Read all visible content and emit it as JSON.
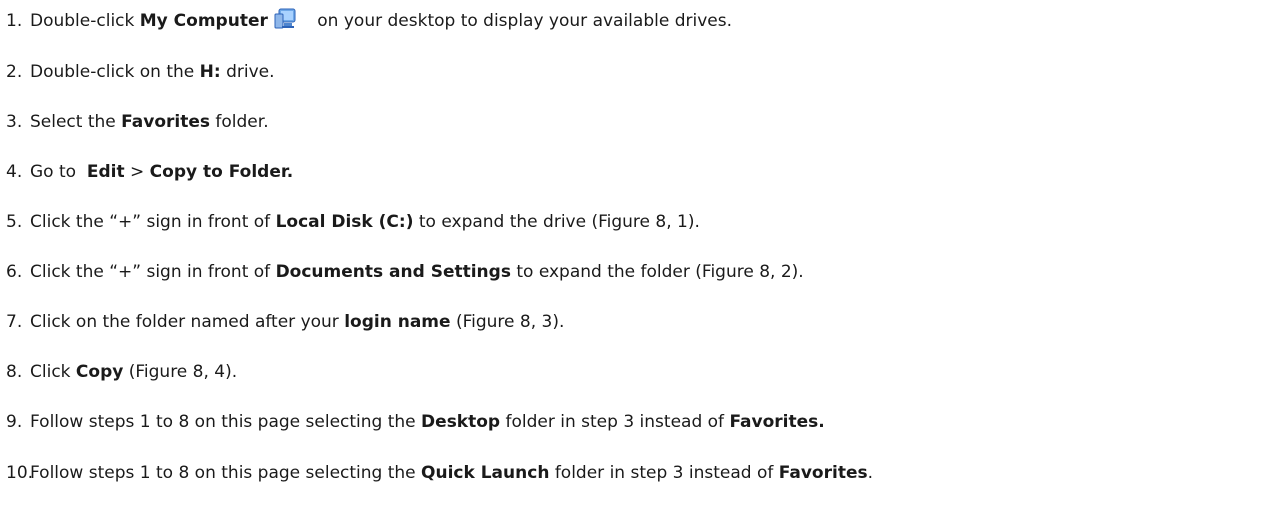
{
  "steps": [
    {
      "number": "1.",
      "parts": [
        "Double-click ",
        "My Computer",
        " on your desktop to display your available drives."
      ],
      "bold": [
        false,
        true,
        false
      ],
      "icon": "my-computer-icon"
    },
    {
      "number": "2.",
      "parts": [
        "Double-click on the ",
        "H:",
        " drive."
      ],
      "bold": [
        false,
        true,
        false
      ]
    },
    {
      "number": "3.",
      "parts": [
        "Select the ",
        "Favorites",
        " folder."
      ],
      "bold": [
        false,
        true,
        false
      ]
    },
    {
      "number": "4.",
      "parts": [
        "Go to  ",
        "Edit",
        " > ",
        "Copy to Folder."
      ],
      "bold": [
        false,
        true,
        false,
        true
      ]
    },
    {
      "number": "5.",
      "parts": [
        "Click the “+” sign in front of ",
        "Local Disk (C:)",
        " to expand the drive (Figure 8, 1)."
      ],
      "bold": [
        false,
        true,
        false
      ]
    },
    {
      "number": "6.",
      "parts": [
        "Click the “+” sign in front of ",
        "Documents and Settings",
        " to expand the folder (Figure 8, 2)."
      ],
      "bold": [
        false,
        true,
        false
      ]
    },
    {
      "number": "7.",
      "parts": [
        "Click on the folder named after your ",
        "login name",
        " (Figure 8, 3)."
      ],
      "bold": [
        false,
        true,
        false
      ]
    },
    {
      "number": "8.",
      "parts": [
        "Click ",
        "Copy",
        " (Figure 8, 4)."
      ],
      "bold": [
        false,
        true,
        false
      ]
    },
    {
      "number": "9.",
      "parts": [
        "Follow steps 1 to 8 on this page selecting the ",
        "Desktop",
        " folder in step 3 instead of ",
        "Favorites."
      ],
      "bold": [
        false,
        true,
        false,
        true
      ]
    },
    {
      "number": "10.",
      "parts": [
        "Follow steps 1 to 8 on this page selecting the ",
        "Quick Launch",
        " folder in step 3 instead of ",
        "Favorites",
        "."
      ],
      "bold": [
        false,
        true,
        false,
        true,
        false
      ]
    }
  ]
}
